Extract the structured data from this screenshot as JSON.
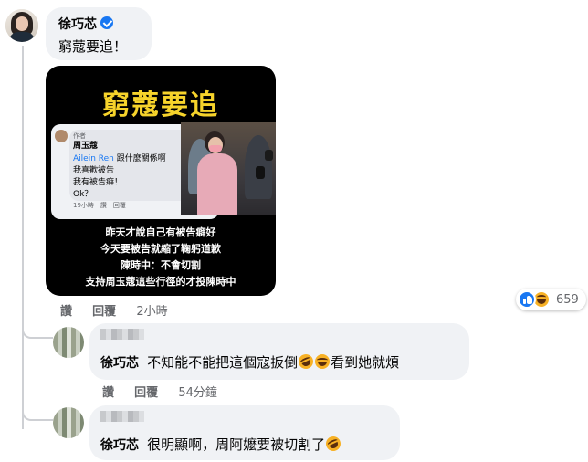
{
  "colors": {
    "accent": "#1877f2",
    "bubble": "#f0f2f5",
    "meta": "#65676b",
    "title_yellow": "#f6d32b"
  },
  "main_comment": {
    "author": "徐巧芯",
    "verified": true,
    "text": "窮蔻要追！",
    "image": {
      "title": "窮蔻要追",
      "fb_card": {
        "author_tag": "作者",
        "name": "周玉蔻",
        "mention": "Ailein Ren",
        "line1_rest": "跟什麼關係啊",
        "line2": "我喜歡被告",
        "line3": "我有被告癖！",
        "line4": "Ok？",
        "meta": "19小時　讚　回覆"
      },
      "captions": [
        "昨天才說自己有被告癖好",
        "今天要被告就縮了鞠躬道歉",
        "陳時中：不會切割",
        "支持周玉蔻這些行徑的才投陳時中"
      ]
    },
    "actions": {
      "like": "讚",
      "reply": "回覆",
      "time": "2小時"
    },
    "reactions": {
      "count": "659",
      "icons": [
        "like-icon",
        "haha-icon"
      ]
    }
  },
  "replies": [
    {
      "author": "徐巧芯",
      "text_before": "不知能不能把這個寇扳倒",
      "text_after": "看到她就煩",
      "emojis": [
        "rofl-icon",
        "haha-icon"
      ],
      "actions": {
        "like": "讚",
        "reply": "回覆",
        "time": "54分鐘"
      }
    },
    {
      "author": "徐巧芯",
      "text_before": "很明顯啊，周阿嬤要被切割了",
      "emojis": [
        "rofl-icon"
      ]
    }
  ]
}
